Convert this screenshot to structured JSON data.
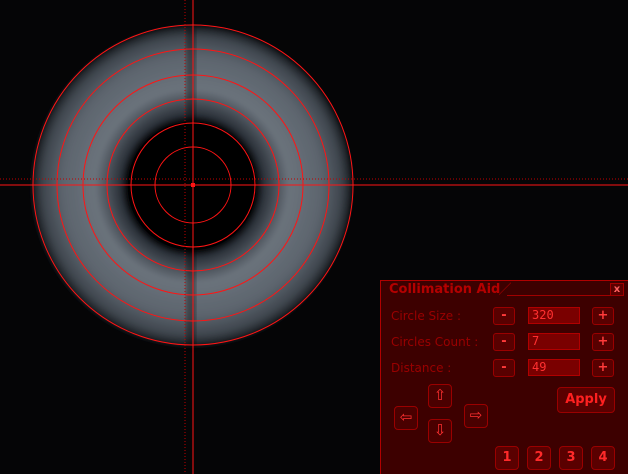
{
  "camera_view": {
    "background": "#050506",
    "overlay_color": "#ff1414",
    "ring_count": 5,
    "crosshair": "dotted"
  },
  "panel": {
    "title": "Collimation Aid",
    "close_label": "x",
    "rows": [
      {
        "label": "Circle Size :",
        "minus": "-",
        "value": "320",
        "plus": "+"
      },
      {
        "label": "Circles Count :",
        "minus": "-",
        "value": "7",
        "plus": "+"
      },
      {
        "label": "Distance :",
        "minus": "-",
        "value": "49",
        "plus": "+"
      }
    ],
    "arrows": {
      "up": "⇧",
      "down": "⇩",
      "left": "⇦",
      "right": "⇨"
    },
    "apply_label": "Apply",
    "presets": [
      "1",
      "2",
      "3",
      "4"
    ],
    "colors": {
      "panel_bg": "#3d0000",
      "accent": "#ff2a2a",
      "border": "#9a0000"
    }
  }
}
